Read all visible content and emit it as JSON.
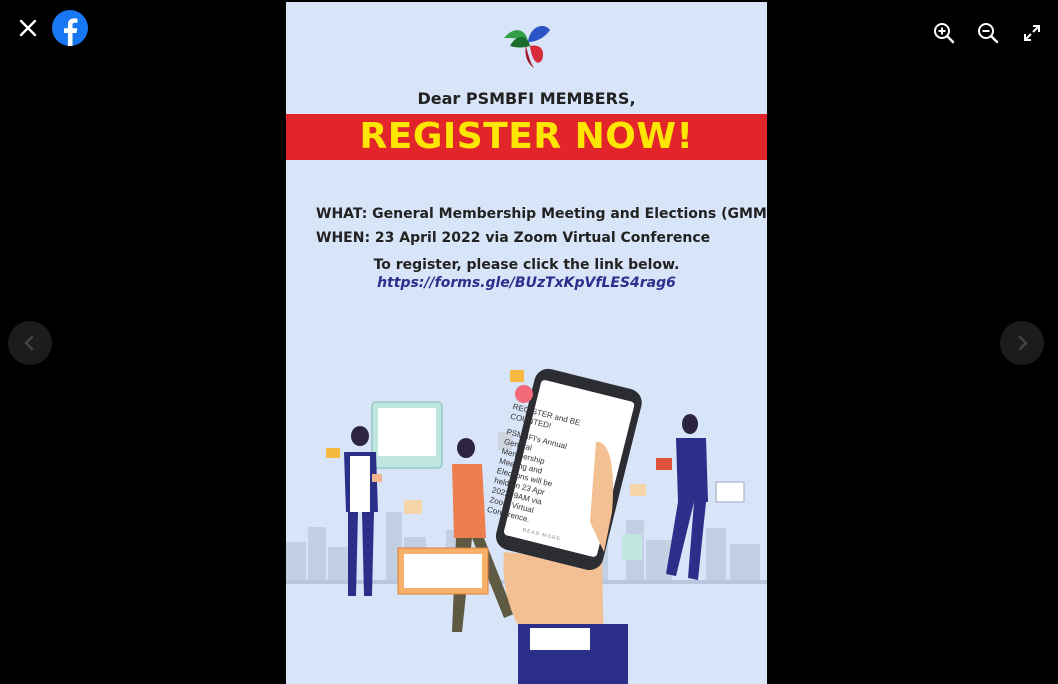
{
  "viewer": {
    "icons": {
      "close": "close-icon",
      "brand": "facebook-logo",
      "zoom_in": "zoom-in-icon",
      "zoom_out": "zoom-out-icon",
      "fullscreen": "fullscreen-icon",
      "prev": "chevron-left-icon",
      "next": "chevron-right-icon"
    },
    "colors": {
      "background": "#000000",
      "facebook_blue": "#1877f2",
      "nav_button": "#1c1c1c"
    }
  },
  "poster": {
    "greeting": "Dear PSMBFI MEMBERS,",
    "headline": "REGISTER NOW!",
    "what": "WHAT: General Membership Meeting and Elections (GMME)",
    "when": "WHEN: 23 April 2022 via Zoom Virtual Conference",
    "register_instruction": "To register, please click the link below.",
    "register_link": "https://forms.gle/BUzTxKpVfLES4rag6",
    "phone_title": "REGISTER and BE COUNTED!",
    "phone_body": "PSMBFI's Annual General Membership Meeting and Elections will be held on 23 Apr 2022, 9AM via Zoom Virtual Conference.",
    "phone_footer": "READ MORE",
    "colors": {
      "background": "#d8e4f7",
      "banner": "#e2252b",
      "headline": "#ffe600",
      "link": "#2a2e8c"
    }
  }
}
